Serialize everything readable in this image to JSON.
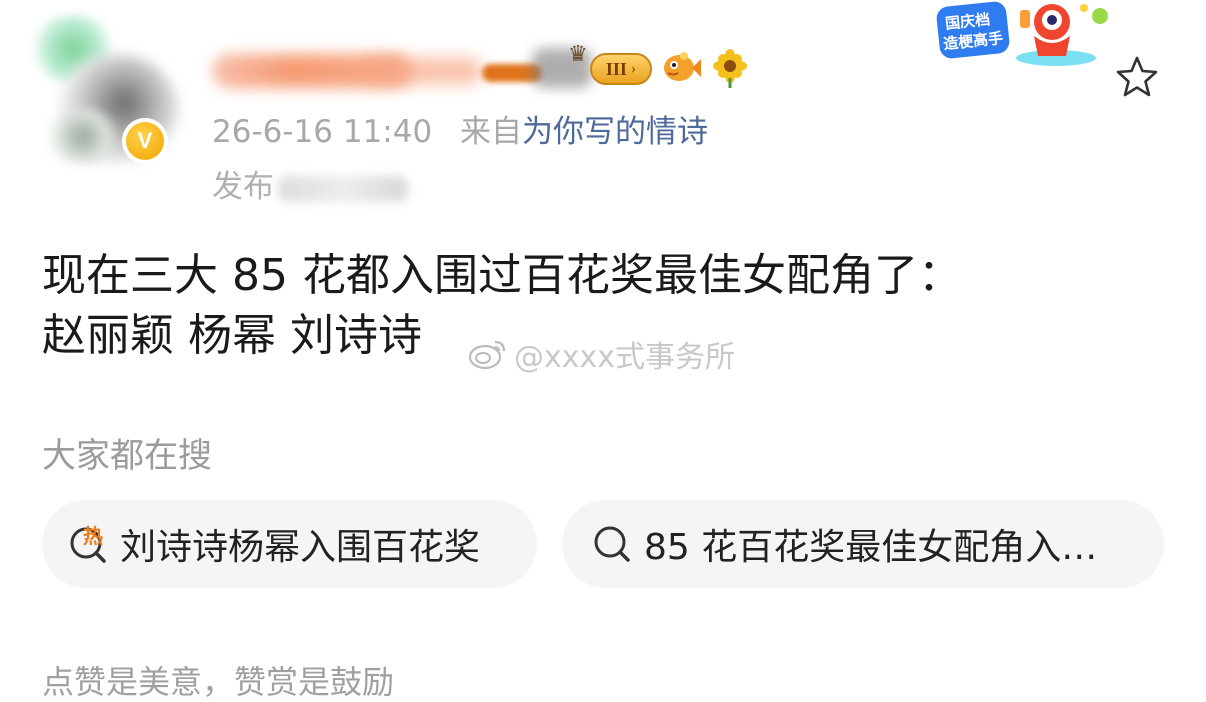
{
  "post_header": {
    "time": "26-6-16 11:40",
    "from_prefix": "来自",
    "source": "为你写的情诗",
    "publish_prefix": "发布",
    "level_badge": "III",
    "icons": [
      "verified-v-icon",
      "crown-icon",
      "fish-icon",
      "sunflower-icon",
      "star-icon"
    ],
    "verified_letter": "V"
  },
  "promo_badge": {
    "line1": "国庆档",
    "line2": "造梗高手"
  },
  "post": {
    "line1": "现在三大 85 花都入围过百花奖最佳女配角了：",
    "line2": "赵丽颖 杨幂 刘诗诗"
  },
  "watermark": {
    "text": "@xxxx式事务所"
  },
  "search": {
    "title": "大家都在搜",
    "chips": [
      {
        "label": "刘诗诗杨幂入围百花奖",
        "hot_mark": "热"
      },
      {
        "label": "85 花百花奖最佳女配角入…"
      }
    ]
  },
  "footer": {
    "text": "点赞是美意，赞赏是鼓励"
  },
  "colors": {
    "source_link": "#4e6a9a",
    "hot_orange": "#f07a1a",
    "chip_bg": "#f5f5f5",
    "muted": "#a3a3a3"
  }
}
